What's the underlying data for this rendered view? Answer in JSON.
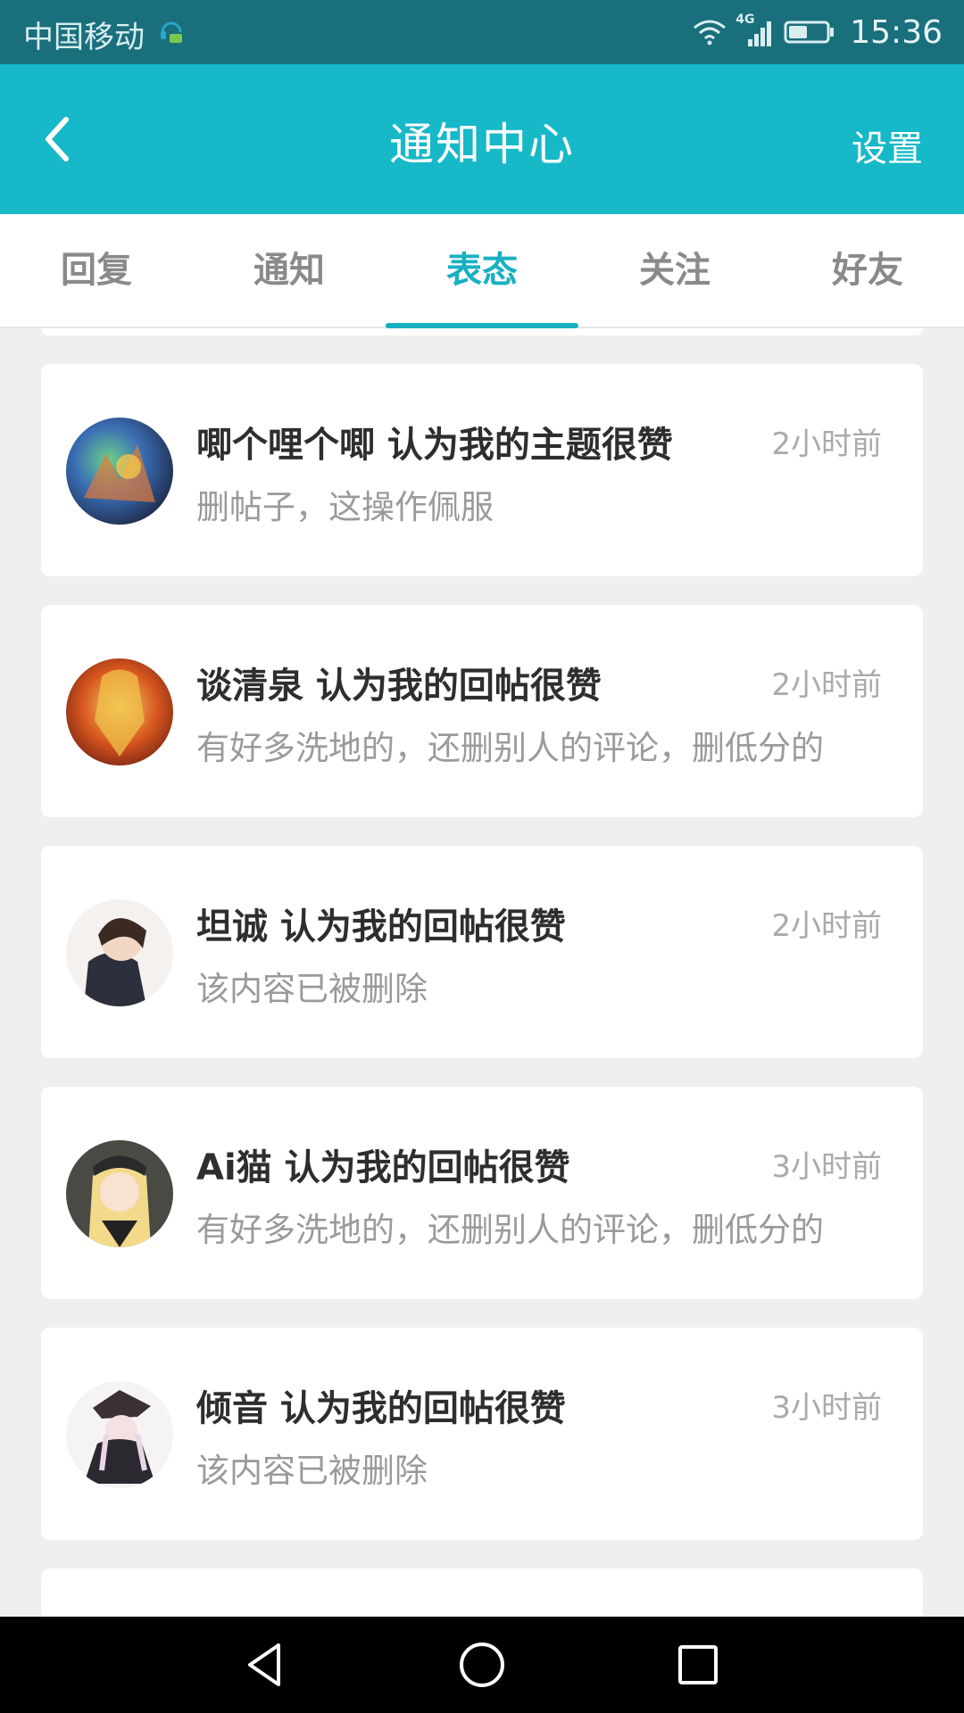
{
  "status_bar": {
    "carrier": "中国移动",
    "network": "4G",
    "time": "15:36"
  },
  "header": {
    "title": "通知中心",
    "settings_label": "设置"
  },
  "tabs": [
    {
      "label": "回复",
      "active": false
    },
    {
      "label": "通知",
      "active": false
    },
    {
      "label": "表态",
      "active": true
    },
    {
      "label": "关注",
      "active": false
    },
    {
      "label": "好友",
      "active": false
    }
  ],
  "notifications": [
    {
      "title": "唧个哩个唧 认为我的主题很赞",
      "time": "2小时前",
      "snippet": "删帖子，这操作佩服"
    },
    {
      "title": "谈清泉 认为我的回帖很赞",
      "time": "2小时前",
      "snippet": "有好多洗地的，还删别人的评论，删低分的"
    },
    {
      "title": "坦诚 认为我的回帖很赞",
      "time": "2小时前",
      "snippet": "该内容已被删除"
    },
    {
      "title": "Ai猫 认为我的回帖很赞",
      "time": "3小时前",
      "snippet": "有好多洗地的，还删别人的评论，删低分的"
    },
    {
      "title": "倾音 认为我的回帖很赞",
      "time": "3小时前",
      "snippet": "该内容已被删除"
    }
  ],
  "colors": {
    "accent": "#17b8c8",
    "status_bar": "#1a6f7c",
    "background": "#efefef"
  },
  "icons": {
    "back": "chevron-left-icon",
    "nav_back": "triangle-back-icon",
    "nav_home": "circle-home-icon",
    "nav_recent": "square-recent-icon"
  }
}
